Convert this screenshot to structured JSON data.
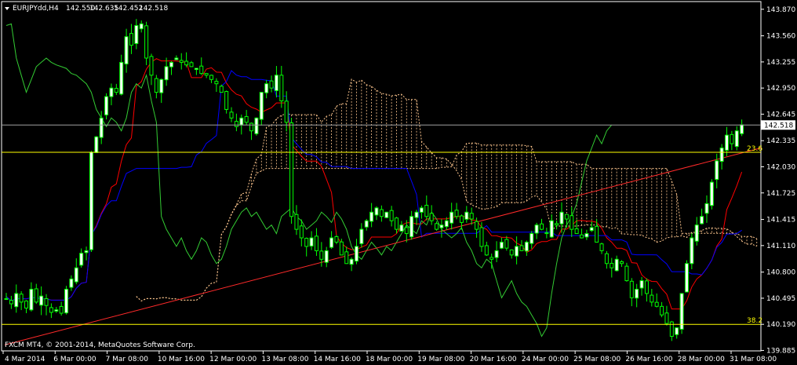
{
  "header": {
    "symbol": "EURJPYdd,H4",
    "open": "142.550",
    "high": "142.635",
    "low": "142.452",
    "close": "142.518"
  },
  "watermark": "FXCM MT4, © 2001-2014, MetaQuotes Software Corp.",
  "current_price_label": "142.518",
  "fib_levels": [
    {
      "label": "23.6",
      "price": 142.2
    },
    {
      "label": "38.2",
      "price": 140.19
    }
  ],
  "colors": {
    "background": "#000000",
    "grid": "#ffffff",
    "candle_bull": "#00ff00",
    "candle_bull_body": "#ffffff",
    "tenkan": "#ff0000",
    "kijun": "#0000ff",
    "chikou": "#33cc33",
    "kumo": "#ffc78f",
    "trendline": "#ff2a2a",
    "fib": "#ffff00",
    "bid_line": "#a0a0a0"
  },
  "chart_data": {
    "type": "candlestick",
    "title": "EURJPYdd,H4",
    "indicators": [
      "Ichimoku Kinko Hyo",
      "Trendline",
      "Fibonacci"
    ],
    "ylim": [
      139.88,
      143.96
    ],
    "y_ticks": [
      "143.870",
      "143.560",
      "143.255",
      "142.950",
      "142.645",
      "142.335",
      "142.030",
      "141.725",
      "141.415",
      "141.110",
      "140.800",
      "140.495",
      "140.190",
      "139.885"
    ],
    "x_ticks": [
      "4 Mar 2014",
      "6 Mar 00:00",
      "7 Mar 08:00",
      "10 Mar 16:00",
      "12 Mar 00:00",
      "13 Mar 08:00",
      "14 Mar 16:00",
      "18 Mar 00:00",
      "19 Mar 08:00",
      "20 Mar 16:00",
      "24 Mar 00:00",
      "25 Mar 08:00",
      "26 Mar 16:00",
      "28 Mar 00:00",
      "31 Mar 08:00"
    ],
    "candles_close": [
      140.49,
      140.43,
      140.55,
      140.45,
      140.38,
      140.6,
      140.45,
      140.52,
      140.41,
      140.33,
      140.36,
      140.32,
      140.6,
      140.72,
      140.85,
      141.02,
      141.05,
      142.2,
      142.38,
      142.6,
      142.85,
      142.95,
      142.9,
      143.25,
      143.55,
      143.45,
      143.68,
      143.7,
      143.3,
      143.1,
      142.9,
      143.05,
      143.2,
      143.25,
      143.3,
      143.25,
      143.22,
      143.2,
      143.18,
      143.12,
      143.1,
      143.05,
      143.0,
      142.9,
      142.7,
      142.6,
      142.5,
      142.6,
      142.55,
      142.45,
      142.6,
      142.9,
      143.0,
      142.95,
      143.1,
      142.8,
      142.55,
      141.45,
      141.3,
      141.2,
      141.1,
      141.2,
      141.05,
      140.95,
      141.05,
      141.2,
      141.15,
      141.0,
      140.9,
      140.95,
      141.1,
      141.3,
      141.4,
      141.5,
      141.55,
      141.45,
      141.5,
      141.4,
      141.3,
      141.35,
      141.25,
      141.45,
      141.5,
      141.55,
      141.45,
      141.4,
      141.3,
      141.35,
      141.4,
      141.5,
      141.45,
      141.38,
      141.5,
      141.42,
      141.3,
      141.1,
      141.0,
      140.95,
      141.05,
      141.15,
      141.08,
      141.0,
      141.1,
      141.05,
      141.15,
      141.25,
      141.35,
      141.3,
      141.25,
      141.4,
      141.35,
      141.5,
      141.42,
      141.3,
      141.25,
      141.2,
      141.25,
      141.32,
      141.15,
      141.05,
      140.9,
      140.85,
      140.95,
      140.9,
      140.7,
      140.5,
      140.6,
      140.7,
      140.55,
      140.45,
      140.4,
      140.3,
      140.2,
      140.05,
      140.15,
      140.55,
      140.9,
      141.2,
      141.35,
      141.45,
      141.6,
      141.85,
      142.1,
      142.25,
      142.4,
      142.3,
      142.45,
      142.52
    ]
  }
}
